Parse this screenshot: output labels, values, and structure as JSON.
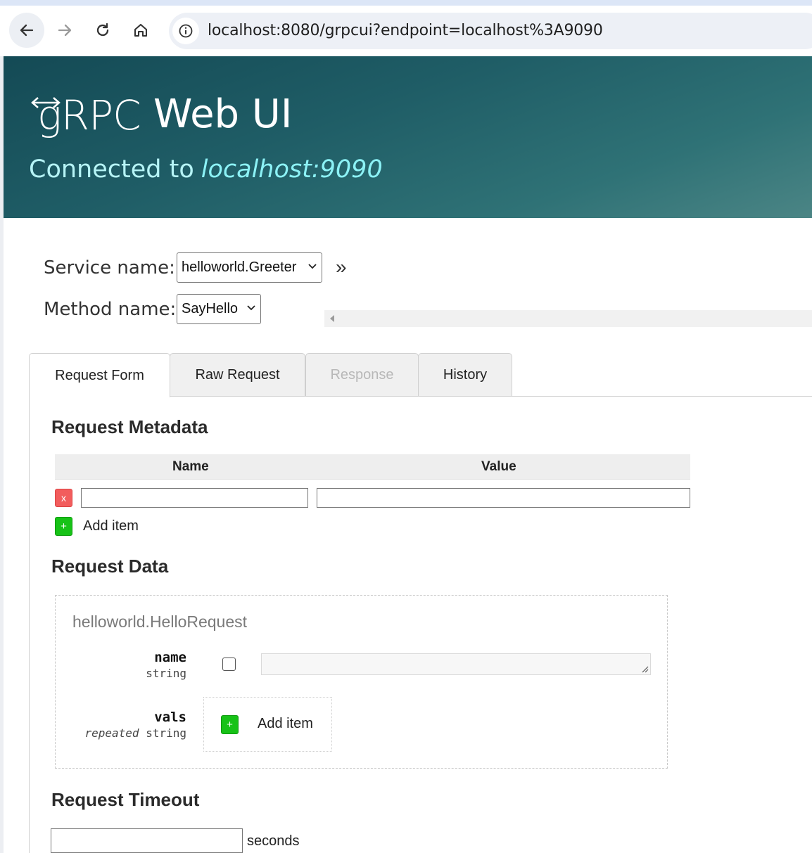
{
  "browser": {
    "url": "localhost:8080/grpcui?endpoint=localhost%3A9090",
    "icons": [
      "back-arrow-icon",
      "forward-arrow-icon",
      "reload-icon",
      "home-icon",
      "site-info-icon"
    ]
  },
  "header": {
    "logo_text": "gRPC",
    "title": "Web UI",
    "connected_label": "Connected to",
    "host": "localhost:9090"
  },
  "service": {
    "label": "Service name:",
    "selected": "helloworld.Greeter",
    "expand_glyph": "»"
  },
  "method": {
    "label": "Method name:",
    "selected": "SayHello"
  },
  "tabs": [
    {
      "label": "Request Form",
      "active": true,
      "disabled": false
    },
    {
      "label": "Raw Request",
      "active": false,
      "disabled": false
    },
    {
      "label": "Response",
      "active": false,
      "disabled": true
    },
    {
      "label": "History",
      "active": false,
      "disabled": false
    }
  ],
  "metadata": {
    "title": "Request Metadata",
    "col_name": "Name",
    "col_value": "Value",
    "remove_label": "x",
    "add_label": "Add item",
    "add_glyph": "+"
  },
  "request_data": {
    "title": "Request Data",
    "message_type": "helloworld.HelloRequest",
    "fields": [
      {
        "name": "name",
        "type": "string",
        "modifier": ""
      },
      {
        "name": "vals",
        "type": "string",
        "modifier": "repeated"
      }
    ],
    "add_label": "Add item",
    "add_glyph": "+"
  },
  "timeout": {
    "title": "Request Timeout",
    "unit": "seconds"
  },
  "colors": {
    "header_dark": "#144a55",
    "header_light": "#4b8585",
    "host_text": "#8cf2f6",
    "remove_button": "#f25d5d",
    "add_button": "#17c217"
  }
}
